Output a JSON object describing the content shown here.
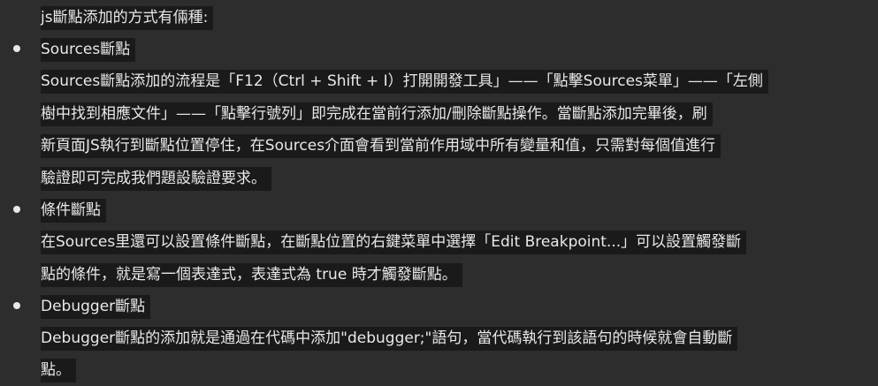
{
  "intro": "js斷點添加的方式有倆種:",
  "sections": [
    {
      "title": "Sources斷點",
      "lines": [
        "Sources斷點添加的流程是「F12（Ctrl + Shift + I）打開開發工具」——「點擊Sources菜單」——「左側",
        "樹中找到相應文件」——「點擊行號列」即完成在當前行添加/刪除斷點操作。當斷點添加完畢後，刷",
        "新頁面JS執行到斷點位置停住，在Sources介面會看到當前作用域中所有變量和值，只需對每個值進行",
        "驗證即可完成我們題設驗證要求。"
      ]
    },
    {
      "title": "條件斷點",
      "lines": [
        "在Sources里還可以設置條件斷點，在斷點位置的右鍵菜單中選擇「Edit Breakpoint...」可以設置觸發斷",
        "點的條件，就是寫一個表達式，表達式為 true 時才觸發斷點。"
      ]
    },
    {
      "title": "Debugger斷點",
      "lines": [
        "Debugger斷點的添加就是通過在代碼中添加\"debugger;\"語句，當代碼執行到該語句的時候就會自動斷",
        "點。"
      ]
    }
  ]
}
